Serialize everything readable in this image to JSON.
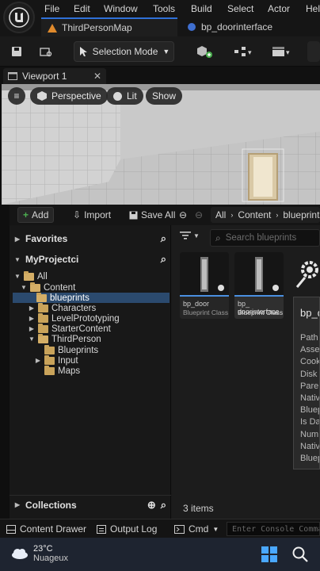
{
  "menu": [
    "File",
    "Edit",
    "Window",
    "Tools",
    "Build",
    "Select",
    "Actor",
    "Help"
  ],
  "doc_tabs": [
    {
      "label": "ThirdPersonMap"
    },
    {
      "label": "bp_doorinterface"
    }
  ],
  "toolbar": {
    "selection_mode": "Selection Mode"
  },
  "viewport": {
    "tab_label": "Viewport 1",
    "perspective": "Perspective",
    "lit": "Lit",
    "show": "Show"
  },
  "content_browser": {
    "add": "Add",
    "import": "Import",
    "save_all": "Save All",
    "path": [
      "All",
      "Content",
      "blueprints"
    ],
    "favorites": "Favorites",
    "project": "MyProjectci",
    "search_placeholder": "Search blueprints",
    "collections": "Collections",
    "item_count": "3 items",
    "tree": [
      "All",
      "Content",
      "blueprints",
      "Characters",
      "LevelPrototyping",
      "StarterContent",
      "ThirdPerson",
      "Blueprints",
      "Input",
      "Maps"
    ],
    "assets": [
      {
        "name": "bp_door",
        "type": "Blueprint Class"
      },
      {
        "name": "bp_doorinterface",
        "name_lines": [
          "bp_",
          "doorinterface"
        ],
        "type": "Blueprint Class"
      }
    ],
    "tooltip": {
      "title": "bp_d",
      "rows": [
        "Path",
        "Asse",
        "Cook",
        "Disk",
        "Pare",
        "Nativ",
        "Bluep",
        "Is Da",
        "Num",
        "Nativ",
        "Bluep"
      ]
    }
  },
  "statusbar": {
    "content_drawer": "Content Drawer",
    "output_log": "Output Log",
    "cmd": "Cmd",
    "console_placeholder": "Enter Console Command"
  },
  "taskbar": {
    "temperature": "23°C",
    "weather": "Nuageux"
  },
  "colors": {
    "accent": "#2f70d8",
    "folder": "#c9a35a",
    "add_green": "#4caf50"
  }
}
